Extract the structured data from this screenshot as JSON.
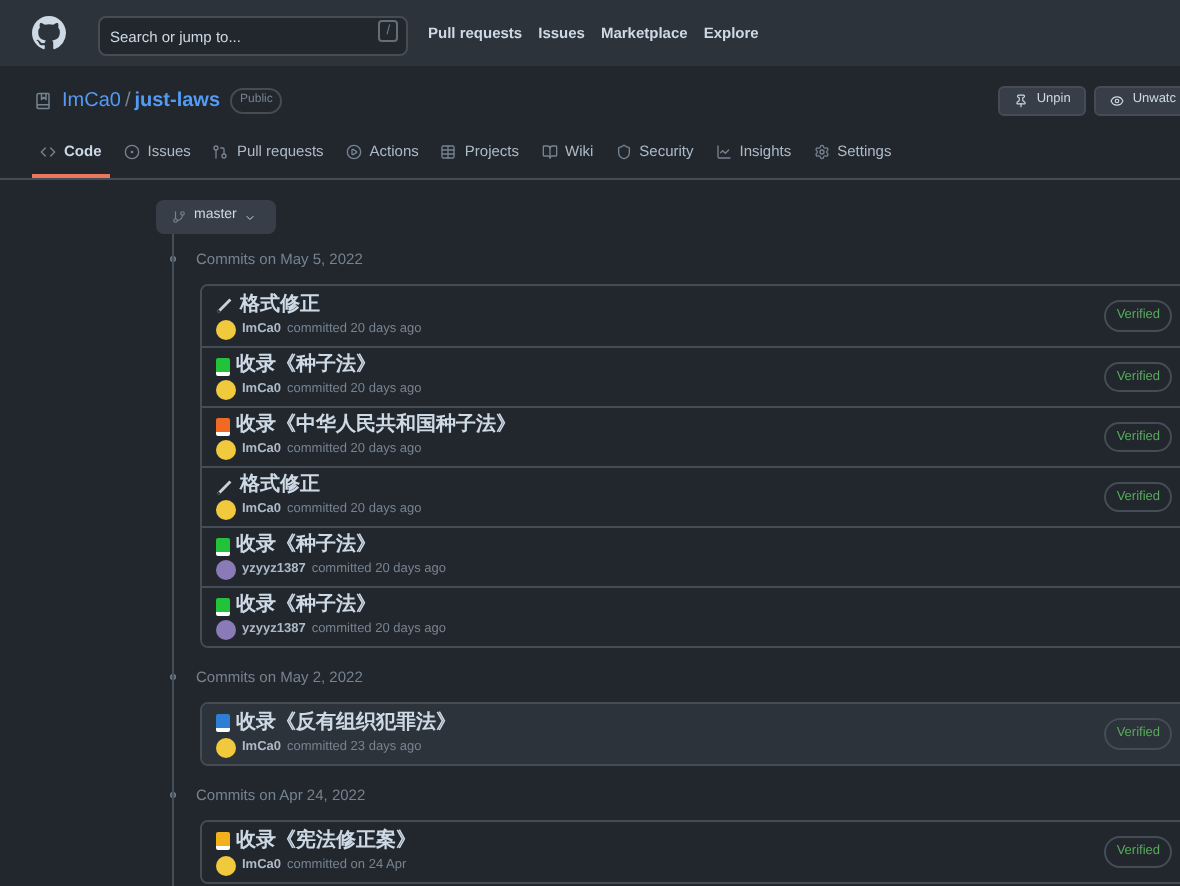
{
  "header": {
    "search": {
      "placeholder": "Search or jump to...",
      "shortcut": "/"
    },
    "nav": [
      "Pull requests",
      "Issues",
      "Marketplace",
      "Explore"
    ]
  },
  "repo": {
    "owner": "ImCa0",
    "separator": "/",
    "name": "just-laws",
    "visibility": "Public",
    "actions": [
      "Unpin",
      "Unwatc"
    ]
  },
  "tabs": [
    {
      "label": "Code",
      "selected": true
    },
    {
      "label": "Issues",
      "selected": false
    },
    {
      "label": "Pull requests",
      "selected": false
    },
    {
      "label": "Actions",
      "selected": false
    },
    {
      "label": "Projects",
      "selected": false
    },
    {
      "label": "Wiki",
      "selected": false
    },
    {
      "label": "Security",
      "selected": false
    },
    {
      "label": "Insights",
      "selected": false
    },
    {
      "label": "Settings",
      "selected": false
    }
  ],
  "branch": "master",
  "groups": [
    {
      "heading": "Commits on May 5, 2022",
      "commits": [
        {
          "icon": {
            "kind": "pencil"
          },
          "message": "格式修正",
          "author": "ImCa0",
          "avatar": {
            "color": "#f0c93c"
          },
          "meta": "committed 20 days ago",
          "badge": "Verified",
          "selected": false
        },
        {
          "icon": {
            "kind": "book",
            "color": "#22c33a"
          },
          "message": "收录《种子法》",
          "author": "ImCa0",
          "avatar": {
            "color": "#f0c93c"
          },
          "meta": "committed 20 days ago",
          "badge": "Verified",
          "selected": false
        },
        {
          "icon": {
            "kind": "book",
            "color": "#f06a24"
          },
          "message": "收录《中华人民共和国种子法》",
          "author": "ImCa0",
          "avatar": {
            "color": "#f0c93c"
          },
          "meta": "committed 20 days ago",
          "badge": "Verified",
          "selected": false
        },
        {
          "icon": {
            "kind": "pencil"
          },
          "message": "格式修正",
          "author": "ImCa0",
          "avatar": {
            "color": "#f0c93c"
          },
          "meta": "committed 20 days ago",
          "badge": "Verified",
          "selected": false
        },
        {
          "icon": {
            "kind": "book",
            "color": "#22c33a"
          },
          "message": "收录《种子法》",
          "author": "yzyyz1387",
          "avatar": {
            "color": "#8a7ab8"
          },
          "meta": "committed 20 days ago",
          "selected": false
        },
        {
          "icon": {
            "kind": "book",
            "color": "#22c33a"
          },
          "message": "收录《种子法》",
          "author": "yzyyz1387",
          "avatar": {
            "color": "#8a7ab8"
          },
          "meta": "committed 20 days ago",
          "selected": false
        }
      ]
    },
    {
      "heading": "Commits on May 2, 2022",
      "commits": [
        {
          "icon": {
            "kind": "book",
            "color": "#2d7fd6"
          },
          "message": "收录《反有组织犯罪法》",
          "author": "ImCa0",
          "avatar": {
            "color": "#f0c93c"
          },
          "meta": "committed 23 days ago",
          "badge": "Verified",
          "selected": true
        }
      ]
    },
    {
      "heading": "Commits on Apr 24, 2022",
      "commits": [
        {
          "icon": {
            "kind": "book",
            "color": "#f2b01c"
          },
          "message": "收录《宪法修正案》",
          "author": "ImCa0",
          "avatar": {
            "color": "#f0c93c"
          },
          "meta": "committed on 24 Apr",
          "badge": "Verified",
          "selected": false
        }
      ]
    }
  ]
}
